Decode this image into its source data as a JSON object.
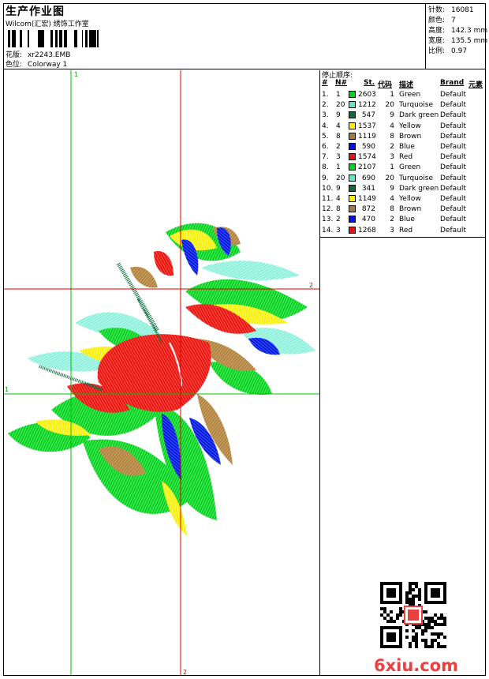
{
  "header": {
    "title": "生产作业图",
    "company": "Wilcom(汇宏) 绣饰工作室",
    "design_label": "花版:",
    "design_value": "xr2243.EMB",
    "colorway_label": "色位:",
    "colorway_value": "Colorway 1"
  },
  "specs": [
    {
      "label": "针数:",
      "value": "16081"
    },
    {
      "label": "颜色:",
      "value": "7"
    },
    {
      "label": "高度:",
      "value": "142.3 mm"
    },
    {
      "label": "宽度:",
      "value": "135.5 mm"
    },
    {
      "label": "比例:",
      "value": "0.97"
    }
  ],
  "guides": {
    "v1": "1",
    "v2": "2",
    "h1": "1",
    "h2": "2",
    "green": "#00c000",
    "red": "#e00000"
  },
  "stop_sequence": {
    "title": "停止顺序:",
    "columns": [
      "#",
      "N#",
      "St.",
      "代码",
      "描述",
      "Brand",
      "元素"
    ],
    "rows": [
      {
        "idx": "1.",
        "n": "1",
        "color": "#00d21f",
        "st": "2603",
        "code": "1",
        "desc": "Green",
        "brand": "Default"
      },
      {
        "idx": "2.",
        "n": "20",
        "color": "#5ee8c8",
        "st": "1212",
        "code": "20",
        "desc": "Turquoise",
        "brand": "Default"
      },
      {
        "idx": "3.",
        "n": "9",
        "color": "#0a6b3c",
        "st": "547",
        "code": "9",
        "desc": "Dark green",
        "brand": "Default"
      },
      {
        "idx": "4.",
        "n": "4",
        "color": "#f8f000",
        "st": "1537",
        "code": "4",
        "desc": "Yellow",
        "brand": "Default"
      },
      {
        "idx": "5.",
        "n": "8",
        "color": "#a87a3a",
        "st": "1119",
        "code": "8",
        "desc": "Brown",
        "brand": "Default"
      },
      {
        "idx": "6.",
        "n": "2",
        "color": "#0016e0",
        "st": "590",
        "code": "2",
        "desc": "Blue",
        "brand": "Default"
      },
      {
        "idx": "7.",
        "n": "3",
        "color": "#e8120e",
        "st": "1574",
        "code": "3",
        "desc": "Red",
        "brand": "Default"
      },
      {
        "idx": "8.",
        "n": "1",
        "color": "#00d21f",
        "st": "2107",
        "code": "1",
        "desc": "Green",
        "brand": "Default"
      },
      {
        "idx": "9.",
        "n": "20",
        "color": "#5ee8c8",
        "st": "690",
        "code": "20",
        "desc": "Turquoise",
        "brand": "Default"
      },
      {
        "idx": "10.",
        "n": "9",
        "color": "#0a6b3c",
        "st": "341",
        "code": "9",
        "desc": "Dark green",
        "brand": "Default"
      },
      {
        "idx": "11.",
        "n": "4",
        "color": "#f8f000",
        "st": "1149",
        "code": "4",
        "desc": "Yellow",
        "brand": "Default"
      },
      {
        "idx": "12.",
        "n": "8",
        "color": "#a87a3a",
        "st": "872",
        "code": "8",
        "desc": "Brown",
        "brand": "Default"
      },
      {
        "idx": "13.",
        "n": "2",
        "color": "#0016e0",
        "st": "470",
        "code": "2",
        "desc": "Blue",
        "brand": "Default"
      },
      {
        "idx": "14.",
        "n": "3",
        "color": "#e8120e",
        "st": "1268",
        "code": "3",
        "desc": "Red",
        "brand": "Default"
      }
    ]
  },
  "watermark": {
    "site": "6xiu.com",
    "brand_color": "#e8413f",
    "qr_icon": "qr-code-icon"
  }
}
